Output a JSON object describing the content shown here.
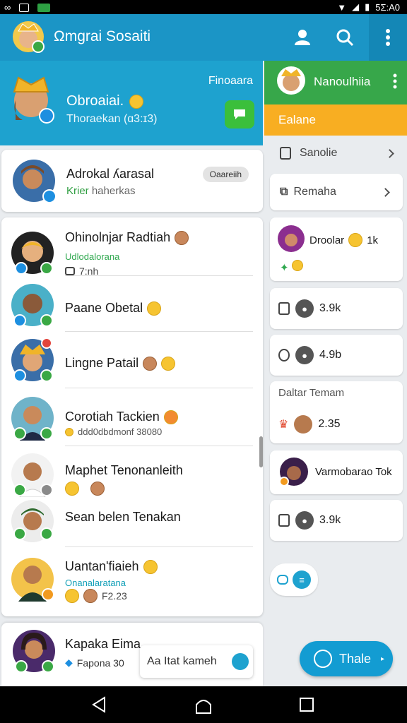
{
  "status_bar": {
    "left_icons": [
      "link-icon",
      "sim-icon",
      "battery-saver-icon"
    ],
    "time": "5Σ:A0"
  },
  "app_bar": {
    "title": "Ωmgrai Sosaiti"
  },
  "hero": {
    "name": "Obroaiai.",
    "subtitle": "Thoraekan (ɑ3:ɪ3)",
    "tag": "Finoaara"
  },
  "pinned": {
    "name": "Adrokal ʎarasal",
    "sub_highlight": "Krier",
    "sub_rest": "haherkas",
    "pill": "Oaareiih"
  },
  "chats": [
    {
      "name": "Ohinolnjar Radtiah",
      "sub": "Udlodalorana",
      "meta": "7:nh"
    },
    {
      "name": "Paane Obetal"
    },
    {
      "name": "Lingne Patail"
    },
    {
      "name": "Corotiah Tackien",
      "meta": "ddd0dbdmonf 38080"
    },
    {
      "name": "Maphet Tenonanleith"
    },
    {
      "name": "Sean belen Tenakan"
    },
    {
      "name": "Uantan'fiaieh",
      "sub": "Onanalaratana",
      "meta": "F2.23"
    }
  ],
  "bottom_chat": {
    "name": "Kapaka Eima",
    "meta": "Fapona 30"
  },
  "composer": {
    "placeholder": "Aa Itat kameh"
  },
  "fab": {
    "label": "Thale"
  },
  "right_panel": {
    "title": "Nanoulhiia",
    "tab": "Ealane",
    "nav": [
      {
        "label": "Sanolie"
      },
      {
        "label": "Remaha"
      }
    ],
    "cards": [
      {
        "label": "Droolar",
        "value": "1k"
      },
      {
        "value": "3.9k"
      },
      {
        "value": "4.9b"
      },
      {
        "title": "Daltar Temam",
        "value": "2.35"
      },
      {
        "label": "Varmobarao Tok"
      },
      {
        "value": "3.9k"
      }
    ]
  },
  "colors": {
    "app_bar": "#1b95c6",
    "hero": "#1ea2cf",
    "panel_head": "#37a74a",
    "tab": "#f8ae22",
    "fab": "#139cd2"
  }
}
